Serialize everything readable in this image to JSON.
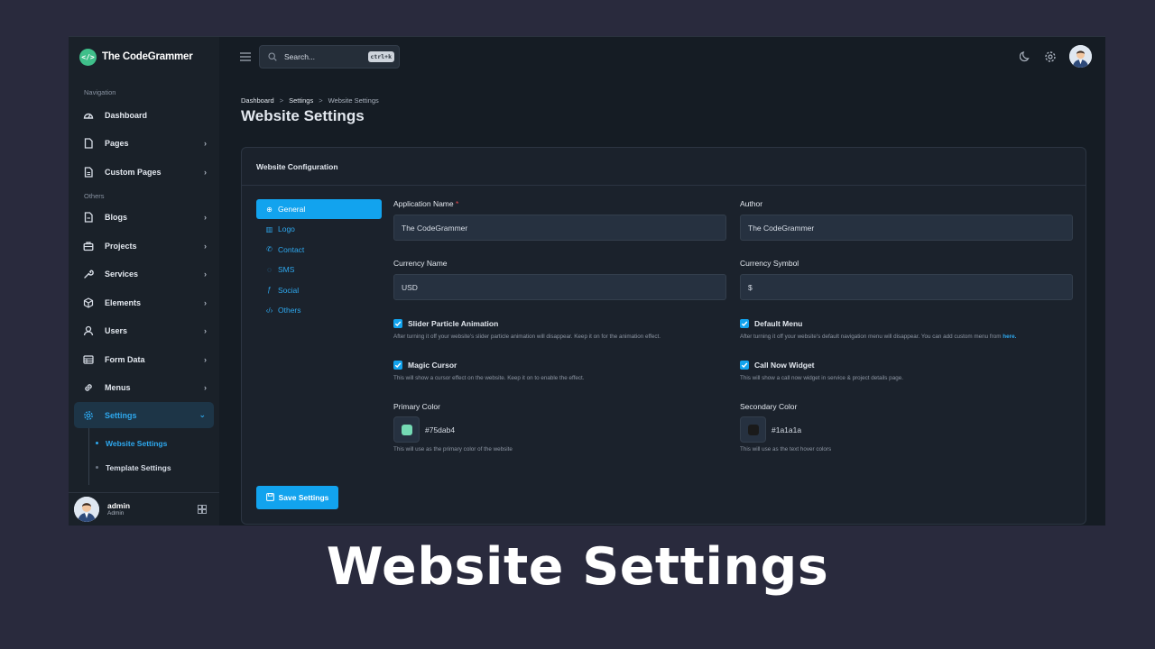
{
  "brand": {
    "name": "The CodeGrammer",
    "logo_glyph": "</>"
  },
  "sidebar": {
    "heading_navigation": "Navigation",
    "heading_others": "Others",
    "nav_top": [
      {
        "label": "Dashboard",
        "icon": "dashboard-icon"
      },
      {
        "label": "Pages",
        "icon": "page-icon"
      },
      {
        "label": "Custom Pages",
        "icon": "custom-page-icon"
      }
    ],
    "nav_others": [
      {
        "label": "Blogs",
        "icon": "blog-icon"
      },
      {
        "label": "Projects",
        "icon": "briefcase-icon"
      },
      {
        "label": "Services",
        "icon": "wrench-icon"
      },
      {
        "label": "Elements",
        "icon": "box-icon"
      },
      {
        "label": "Users",
        "icon": "user-icon"
      },
      {
        "label": "Form Data",
        "icon": "table-icon"
      },
      {
        "label": "Menus",
        "icon": "link-icon"
      },
      {
        "label": "Settings",
        "icon": "gear-icon"
      }
    ],
    "sub_items": [
      {
        "label": "Website Settings"
      },
      {
        "label": "Template Settings"
      }
    ],
    "user": {
      "name": "admin",
      "role": "Admin"
    }
  },
  "topbar": {
    "search_placeholder": "Search...",
    "search_shortcut": "ctrl+k"
  },
  "breadcrumb": [
    "Dashboard",
    "Settings",
    "Website Settings"
  ],
  "breadcrumb_separator": ">",
  "page_title": "Website Settings",
  "card": {
    "title": "Website Configuration",
    "tabs": [
      {
        "label": "General",
        "glyph": "⊕",
        "icon": "globe-icon"
      },
      {
        "label": "Logo",
        "glyph": "▥",
        "icon": "image-icon"
      },
      {
        "label": "Contact",
        "glyph": "✆",
        "icon": "phone-icon"
      },
      {
        "label": "SMS",
        "glyph": "◌",
        "icon": "chat-icon"
      },
      {
        "label": "Social",
        "glyph": "ƒ",
        "icon": "facebook-icon"
      },
      {
        "label": "Others",
        "glyph": "‹/›",
        "icon": "code-icon"
      }
    ],
    "fields": {
      "app_name_label": "Application Name",
      "app_name_required": "*",
      "app_name_value": "The CodeGrammer",
      "author_label": "Author",
      "author_value": "The CodeGrammer",
      "currency_name_label": "Currency Name",
      "currency_name_value": "USD",
      "currency_symbol_label": "Currency Symbol",
      "currency_symbol_value": "$"
    },
    "checks": {
      "slider": {
        "label": "Slider Particle Animation",
        "checked": true,
        "help": "After turning it off your website's slider particle animation will disappear. Keep it on for the animation effect."
      },
      "default_menu": {
        "label": "Default Menu",
        "checked": true,
        "help": "After turning it off your website's default navigation menu will disappear. You can add custom menu from",
        "help_link": "here."
      },
      "magic_cursor": {
        "label": "Magic Cursor",
        "checked": true,
        "help": "This will show a cursor effect on the website. Keep it on to enable the effect."
      },
      "call_now": {
        "label": "Call Now Widget",
        "checked": true,
        "help": "This will show a call now widget in service & project details page."
      }
    },
    "colors": {
      "primary_label": "Primary Color",
      "primary_value": "#75dab4",
      "primary_help": "This will use as the primary color of the website",
      "secondary_label": "Secondary Color",
      "secondary_value": "#1a1a1a",
      "secondary_help": "This will use as the text hover colors"
    },
    "save_label": "Save Settings"
  },
  "caption": "Website Settings",
  "theme": {
    "accent": "#12a3ee",
    "brand_green": "#3fbf8a",
    "background": "#292a3d"
  }
}
